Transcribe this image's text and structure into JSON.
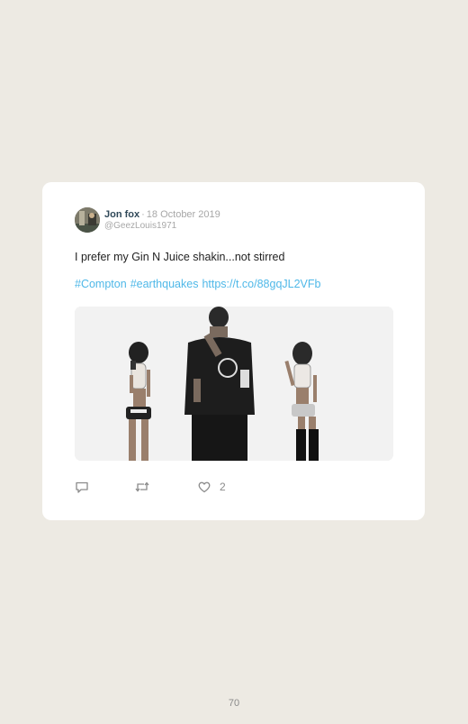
{
  "tweet": {
    "author_name": "Jon fox",
    "separator": "·",
    "date": "18 October 2019",
    "handle": "@GeezLouis1971",
    "text": "I prefer my Gin N Juice shakin...not stirred",
    "hashtags": [
      "#Compton",
      "#earthquakes"
    ],
    "link": "https://t.co/88gqJL2VFb",
    "like_count": "2"
  },
  "icons": {
    "reply": "speech-bubble-icon",
    "retweet": "retweet-icon",
    "like": "heart-icon"
  },
  "colors": {
    "background": "#edeae3",
    "card": "#ffffff",
    "link": "#4fb8e8",
    "name": "#2f4858",
    "meta": "#a7a7a7"
  },
  "page": {
    "number": "70"
  }
}
